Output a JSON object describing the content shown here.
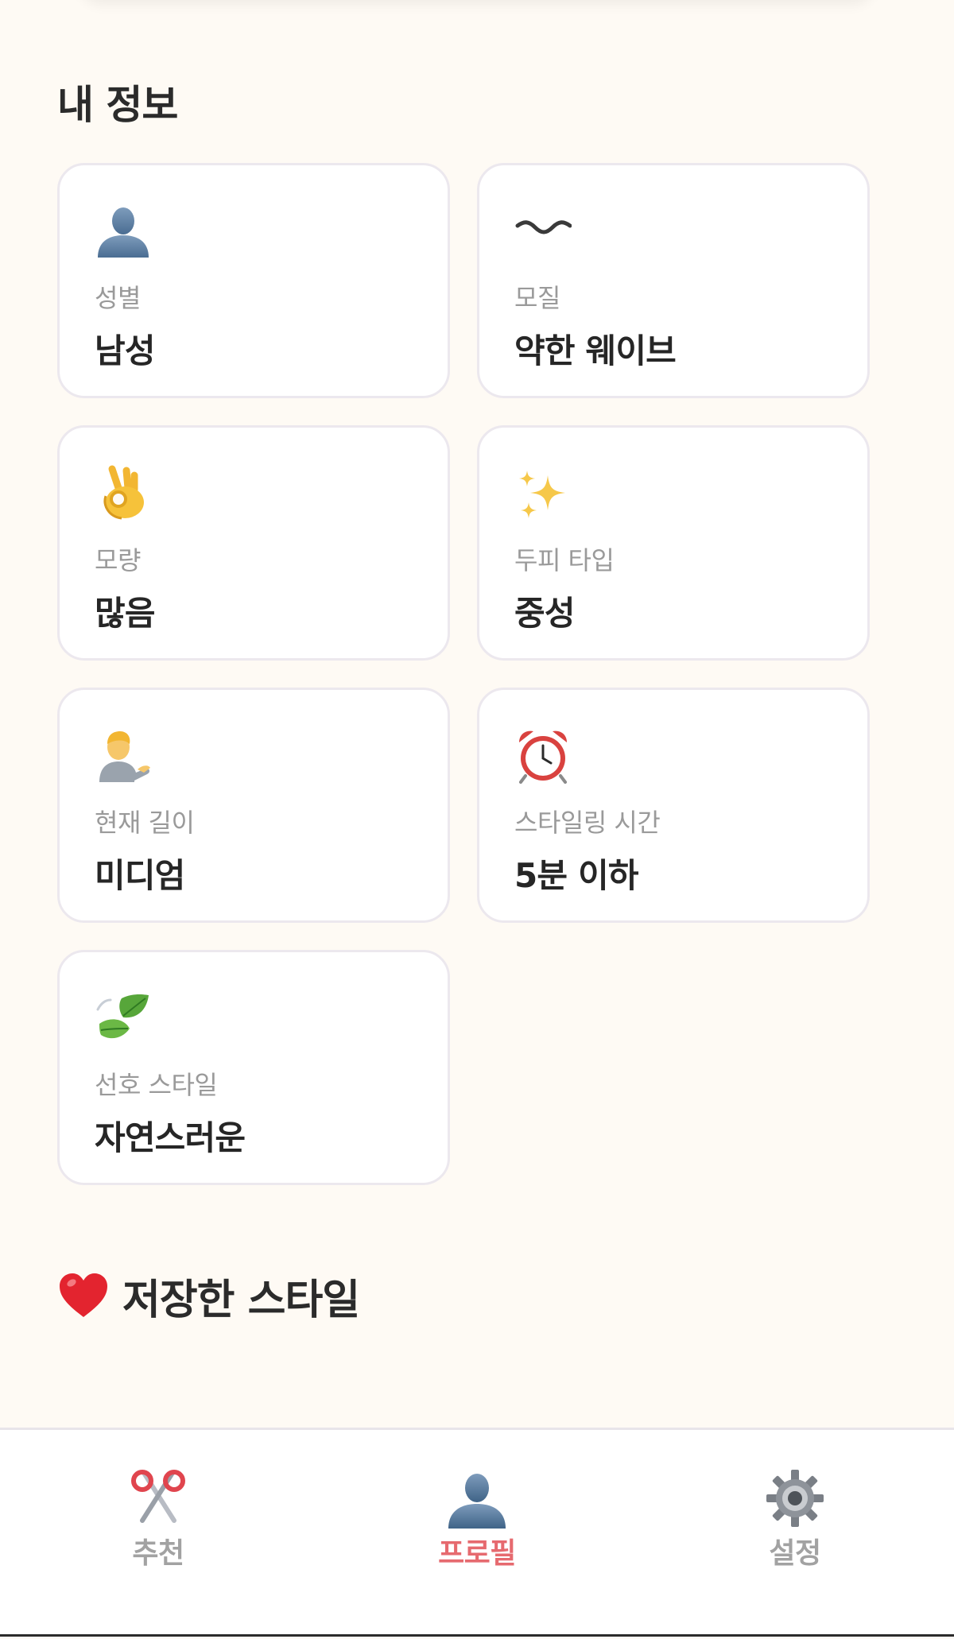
{
  "colors": {
    "background": "#fefaf4",
    "card": "#ffffff",
    "card_border": "#ece8ee",
    "label": "#9a9a9a",
    "value": "#262626",
    "nav_inactive": "#a2a2a2",
    "nav_active": "#e66a6f"
  },
  "my_info": {
    "title": "내 정보",
    "cards": [
      {
        "icon": "person-silhouette-icon",
        "label": "성별",
        "value": "남성"
      },
      {
        "icon": "wavy-line-icon",
        "label": "모질",
        "value": "약한 웨이브"
      },
      {
        "icon": "ok-hand-icon",
        "label": "모량",
        "value": "많음"
      },
      {
        "icon": "sparkles-icon",
        "label": "두피 타입",
        "value": "중성"
      },
      {
        "icon": "person-tipping-hand-icon",
        "label": "현재 길이",
        "value": "미디엄"
      },
      {
        "icon": "alarm-clock-icon",
        "label": "스타일링 시간",
        "value": "5분 이하"
      },
      {
        "icon": "leaves-icon",
        "label": "선호 스타일",
        "value": "자연스러운"
      }
    ]
  },
  "saved_styles": {
    "icon": "red-heart-icon",
    "title": "저장한 스타일"
  },
  "bottom_nav": {
    "active": "profile",
    "items": [
      {
        "id": "recommend",
        "icon": "scissors-icon",
        "label": "추천"
      },
      {
        "id": "profile",
        "icon": "person-silhouette-icon",
        "label": "프로필"
      },
      {
        "id": "settings",
        "icon": "gear-icon",
        "label": "설정"
      }
    ]
  }
}
